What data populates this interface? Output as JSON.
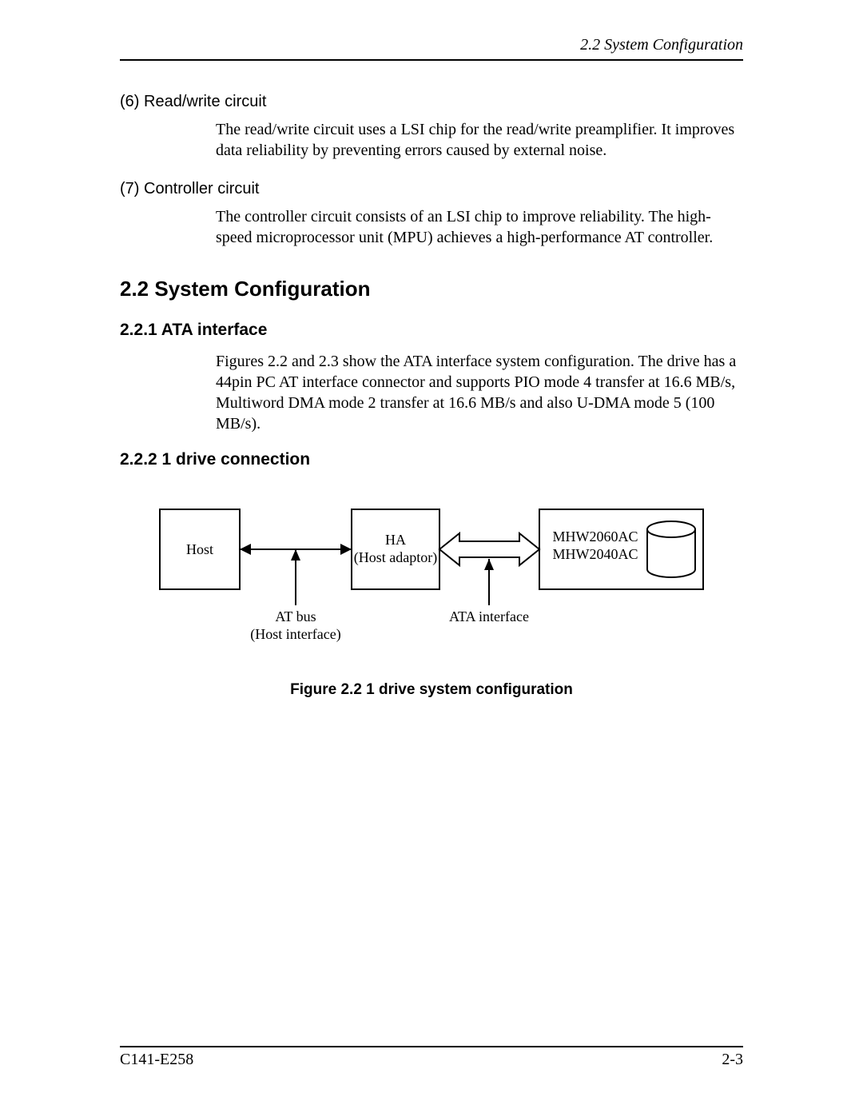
{
  "header": {
    "running_title": "2.2  System Configuration"
  },
  "items": {
    "item6": {
      "label": "(6)  Read/write circuit",
      "body": "The read/write circuit uses a LSI chip for the read/write preamplifier.  It improves data reliability by preventing errors caused by external noise."
    },
    "item7": {
      "label": "(7)  Controller circuit",
      "body": "The controller circuit consists of an LSI chip to improve reliability.  The high-speed microprocessor unit (MPU) achieves a high-performance AT controller."
    }
  },
  "section": {
    "heading": "2.2  System Configuration",
    "sub1": {
      "heading": "2.2.1  ATA interface",
      "body": "Figures 2.2 and 2.3 show the ATA interface system configuration.  The drive has a 44pin PC AT interface connector and supports PIO mode 4 transfer at 16.6 MB/s, Multiword DMA mode 2 transfer at 16.6 MB/s and also U-DMA mode 5 (100 MB/s)."
    },
    "sub2": {
      "heading": "2.2.2  1 drive connection"
    }
  },
  "figure": {
    "host": "Host",
    "ha_line1": "HA",
    "ha_line2": "(Host adaptor)",
    "drive_line1": "MHW2060AC",
    "drive_line2": "MHW2040AC",
    "atbus_line1": "AT bus",
    "atbus_line2": "(Host interface)",
    "atainterface": "ATA interface",
    "caption": "Figure 2.2  1 drive system configuration"
  },
  "footer": {
    "left": "C141-E258",
    "right": "2-3"
  }
}
